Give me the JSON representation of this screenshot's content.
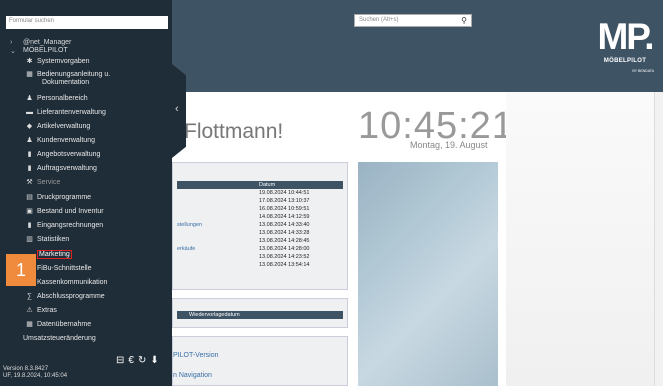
{
  "header": {
    "search_placeholder": "Suchen (Alt+s)",
    "logo": {
      "mark": "MP.",
      "brand": "MÖBELPILOT",
      "sub": "BY BENDATA"
    }
  },
  "main": {
    "greeting": "Flottmann!",
    "clock": "10:45:21",
    "date": "Montag, 19. August",
    "table1": {
      "column": "Datum",
      "rows": [
        {
          "label": "",
          "date": "19.08.2024 10:44:51"
        },
        {
          "label": "",
          "date": "17.08.2024 13:10:37"
        },
        {
          "label": "",
          "date": "16.08.2024 10:59:51"
        },
        {
          "label": "",
          "date": "14.08.2024 14:12:59"
        },
        {
          "label": "stellungen",
          "date": "13.08.2024 14:33:40"
        },
        {
          "label": "",
          "date": "13.08.2024 14:33:28"
        },
        {
          "label": "",
          "date": "13.08.2024 14:28:45"
        },
        {
          "label": "erkäufe",
          "date": "13.08.2024 14:28:00"
        },
        {
          "label": "",
          "date": "13.08.2024 14:23:52"
        },
        {
          "label": "",
          "date": "13.08.2024 13:54:14"
        }
      ]
    },
    "table2": {
      "column": "Wiedervorlagedatum"
    },
    "links": {
      "version": "PILOT-Version",
      "navigation": "n Navigation"
    }
  },
  "sidebar": {
    "search_placeholder": "Formular suchen",
    "user": "@net_Manager",
    "company": "MÖBELPILOT",
    "items": [
      {
        "label": "Systemvorgaben",
        "icon": "gear-icon",
        "glyph": "✱"
      },
      {
        "label": "Bedienungsanleitung u.",
        "label2": "Dokumentation",
        "icon": "grid-icon",
        "glyph": "▦"
      },
      {
        "label": "Personalbereich",
        "icon": "person-icon",
        "glyph": "♟"
      },
      {
        "label": "Lieferantenverwaltung",
        "icon": "truck-icon",
        "glyph": "▬"
      },
      {
        "label": "Artikelverwaltung",
        "icon": "tag-icon",
        "glyph": "◆"
      },
      {
        "label": "Kundenverwaltung",
        "icon": "people-icon",
        "glyph": "♟"
      },
      {
        "label": "Angebotsverwaltung",
        "icon": "document-icon",
        "glyph": "▮"
      },
      {
        "label": "Auftragsverwaltung",
        "icon": "document-icon",
        "glyph": "▮"
      },
      {
        "label": "Service",
        "icon": "wrench-icon",
        "glyph": "⚒"
      },
      {
        "label": "Druckprogramme",
        "icon": "printer-icon",
        "glyph": "▤"
      },
      {
        "label": "Bestand und Inventur",
        "icon": "box-icon",
        "glyph": "▣"
      },
      {
        "label": "Eingangsrechnungen",
        "icon": "invoice-icon",
        "glyph": "▮"
      },
      {
        "label": "Statistiken",
        "icon": "chart-icon",
        "glyph": "▥"
      },
      {
        "label": "Marketing",
        "icon": "marketing-icon",
        "glyph": ""
      },
      {
        "label": "FiBu-Schnittstelle",
        "icon": "interface-icon",
        "glyph": ""
      },
      {
        "label": "Kassenkommunikation",
        "icon": "register-icon",
        "glyph": "●"
      },
      {
        "label": "Abschlussprogramme",
        "icon": "sum-icon",
        "glyph": "∑"
      },
      {
        "label": "Extras",
        "icon": "extras-icon",
        "glyph": "⚠"
      },
      {
        "label": "Datenübernahme",
        "icon": "database-icon",
        "glyph": "▦"
      },
      {
        "label": "Umsatzsteueränderung",
        "icon": "",
        "glyph": ""
      }
    ],
    "step_badge": "1",
    "bottom_icons": [
      "logout-icon",
      "euro-icon",
      "refresh-icon",
      "pin-icon"
    ],
    "bottom_glyphs": [
      "⊟",
      "€",
      "↻",
      "⬇"
    ],
    "version_line1": "Version 8.3.8427",
    "version_line2": "UF, 19.8.2024, 10:45:04"
  }
}
